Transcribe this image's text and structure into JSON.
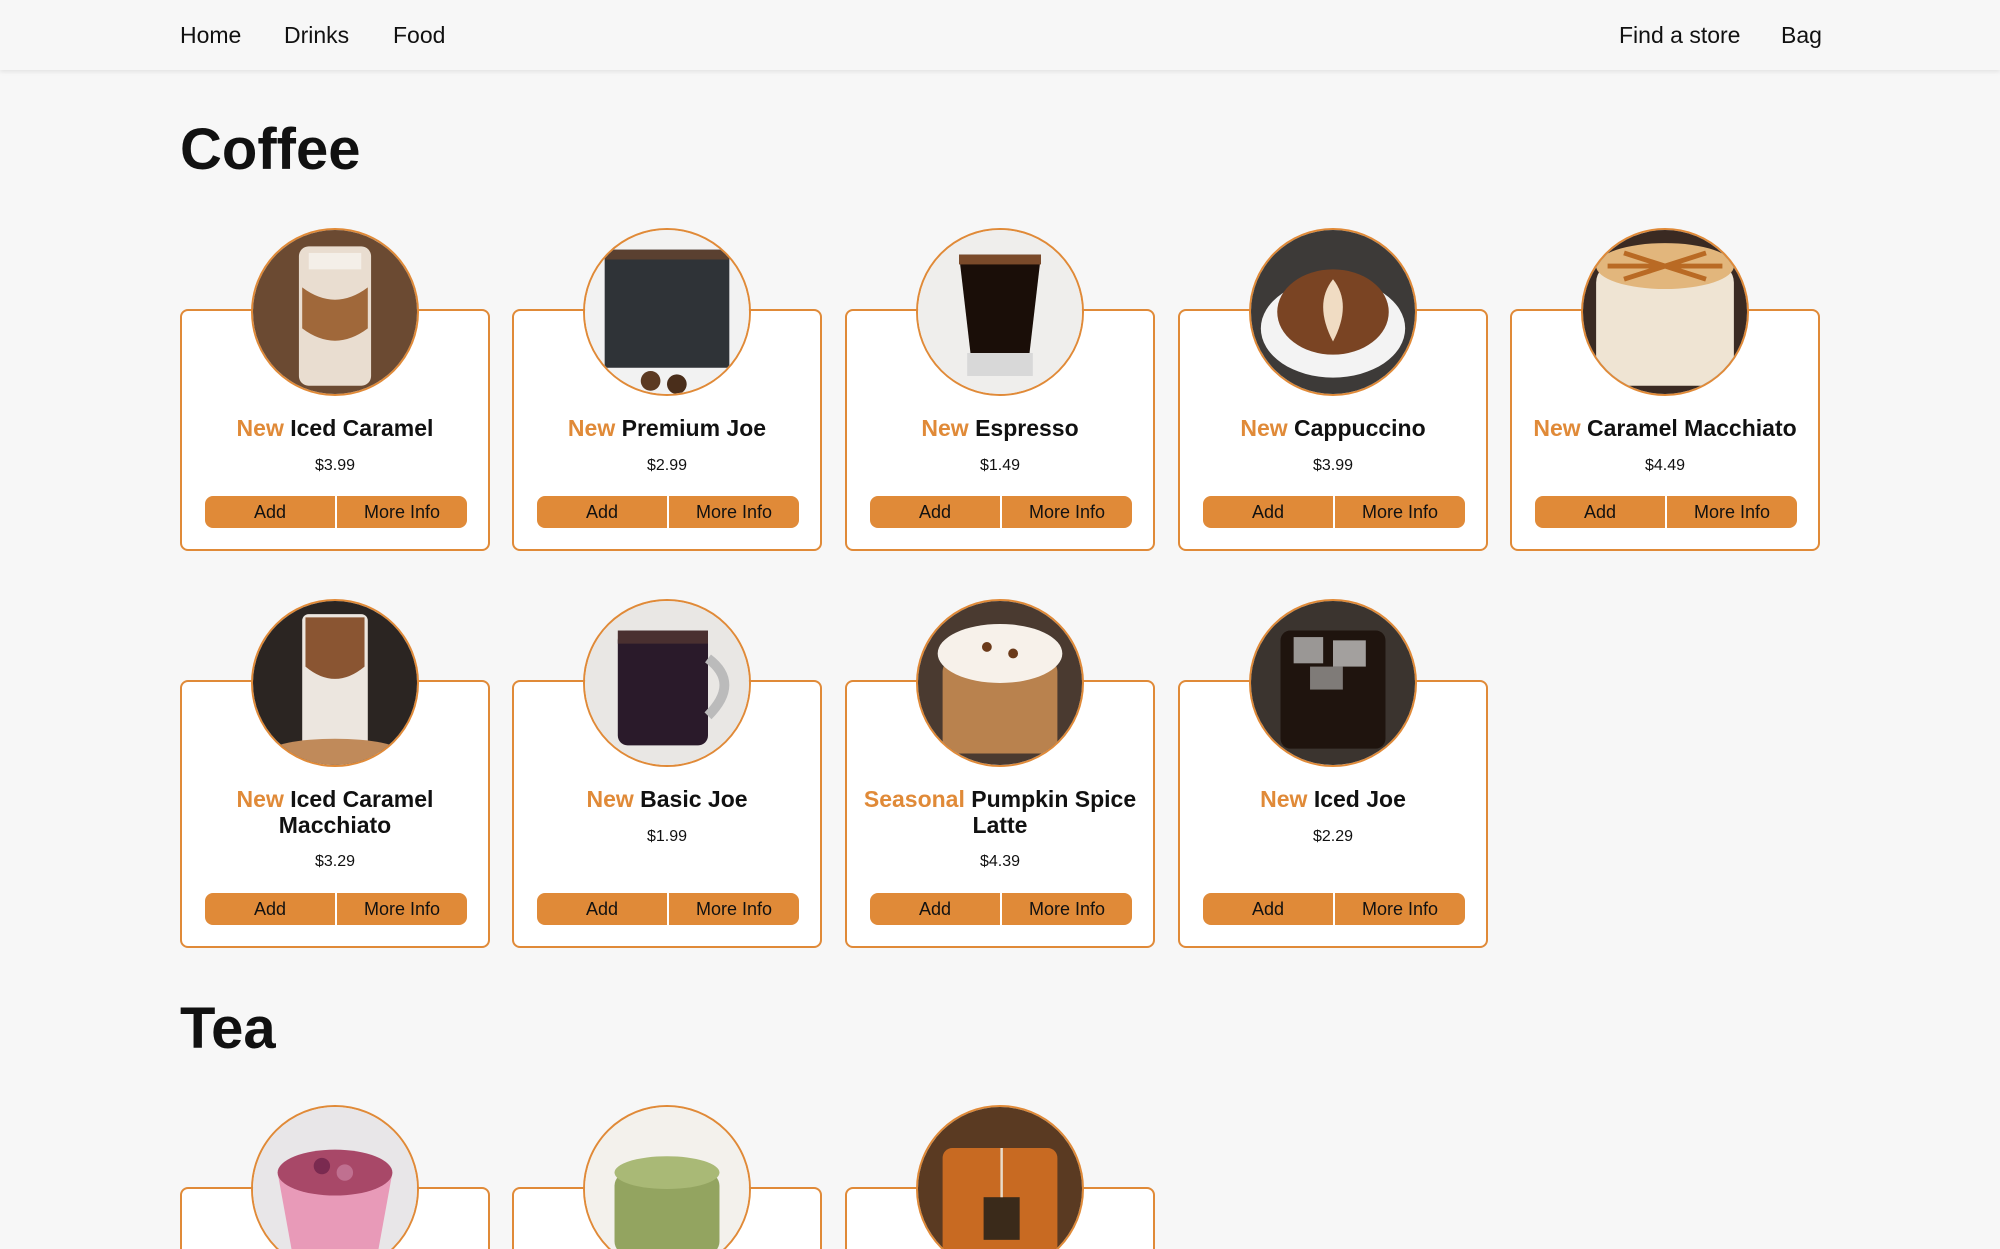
{
  "nav": {
    "home": "Home",
    "drinks": "Drinks",
    "food": "Food",
    "find_store": "Find a store",
    "bag": "Bag"
  },
  "sections": {
    "coffee": "Coffee",
    "tea": "Tea"
  },
  "buttons": {
    "add": "Add",
    "more_info": "More Info"
  },
  "accent_color": "#e08a38",
  "coffee": [
    {
      "tag": "New",
      "name": "Iced Caramel",
      "price": "$3.99",
      "image": "iced-caramel-photo"
    },
    {
      "tag": "New",
      "name": "Premium Joe",
      "price": "$2.99",
      "image": "premium-joe-photo"
    },
    {
      "tag": "New",
      "name": "Espresso",
      "price": "$1.49",
      "image": "espresso-photo"
    },
    {
      "tag": "New",
      "name": "Cappuccino",
      "price": "$3.99",
      "image": "cappuccino-photo"
    },
    {
      "tag": "New",
      "name": "Caramel Macchiato",
      "price": "$4.49",
      "image": "caramel-macchiato-photo"
    },
    {
      "tag": "New",
      "name": "Iced Caramel Macchiato",
      "price": "$3.29",
      "image": "iced-caramel-macchiato-photo"
    },
    {
      "tag": "New",
      "name": "Basic Joe",
      "price": "$1.99",
      "image": "basic-joe-photo"
    },
    {
      "tag": "Seasonal",
      "name": "Pumpkin Spice Latte",
      "price": "$4.39",
      "image": "pumpkin-spice-latte-photo"
    },
    {
      "tag": "New",
      "name": "Iced Joe",
      "price": "$2.29",
      "image": "iced-joe-photo"
    }
  ],
  "tea_images": [
    "rose-tea-photo",
    "matcha-latte-photo",
    "black-tea-photo"
  ]
}
